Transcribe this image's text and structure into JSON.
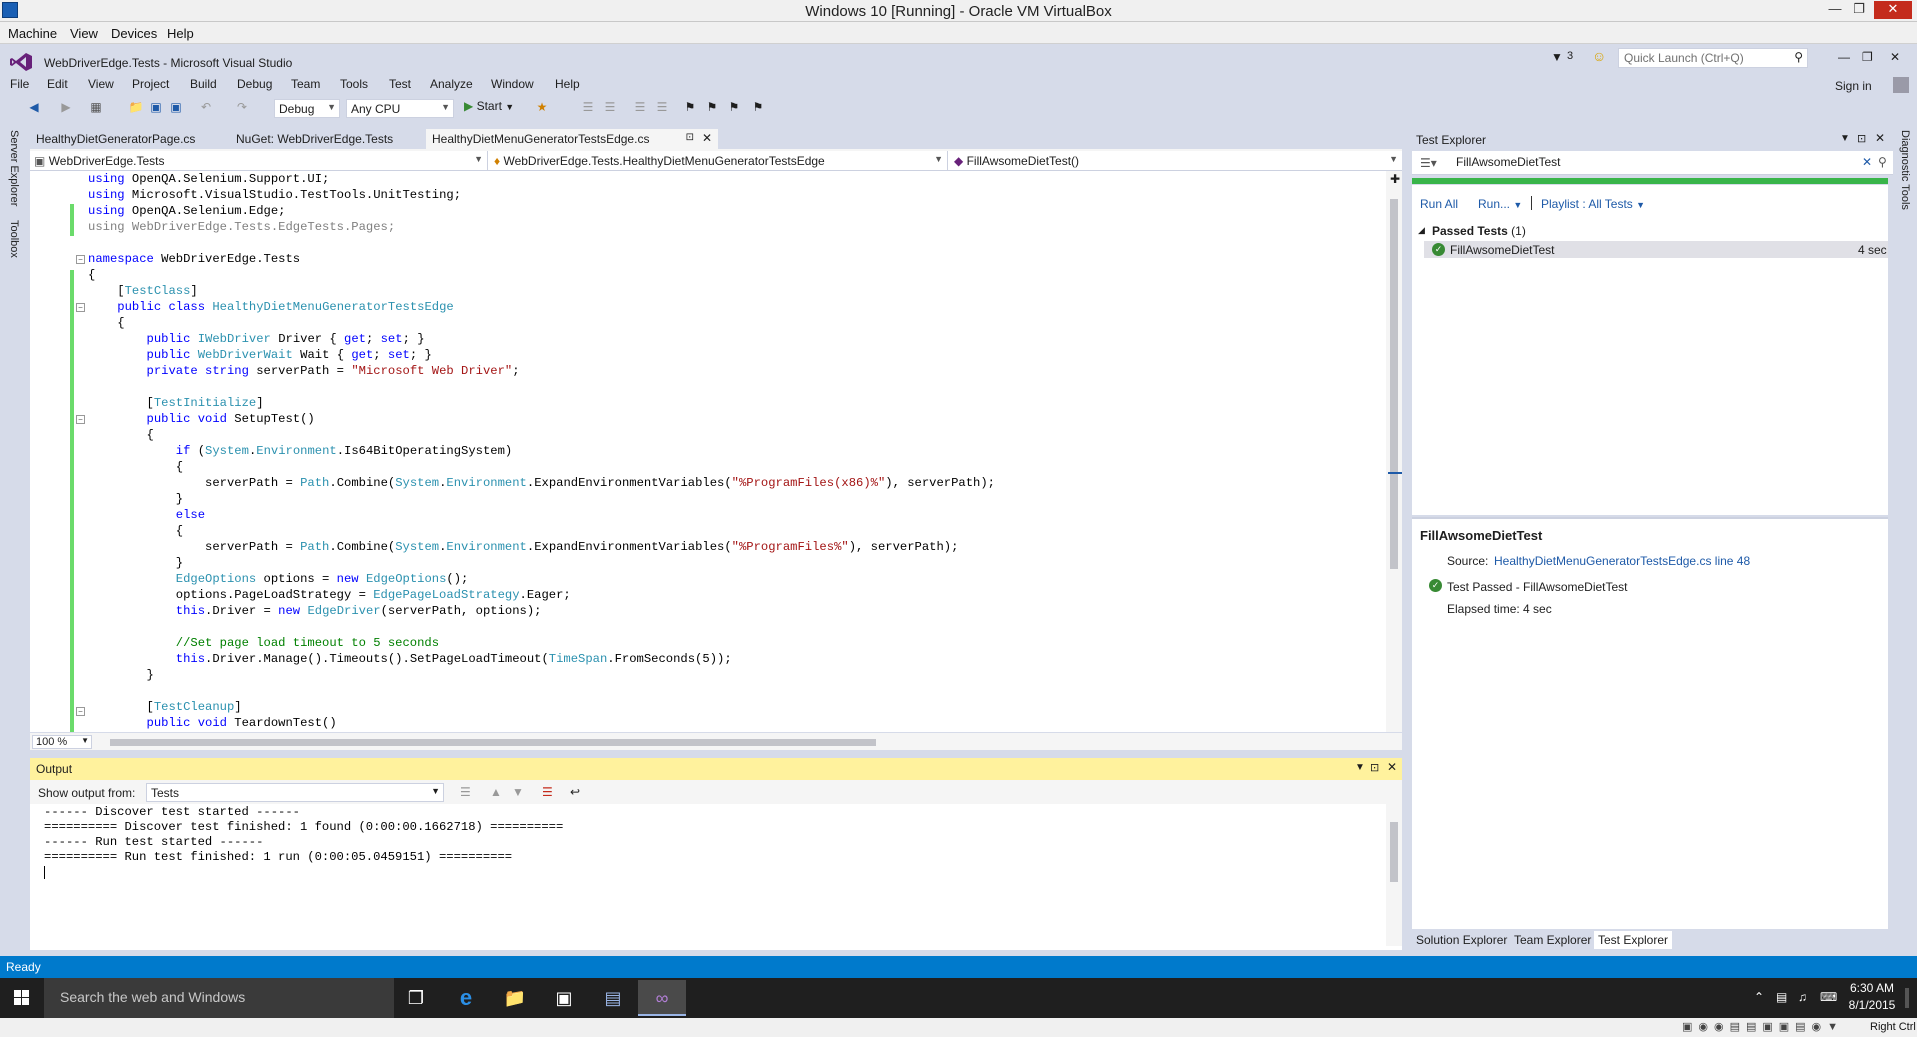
{
  "vbox": {
    "title": "Windows 10 [Running] - Oracle VM VirtualBox",
    "menu": [
      "Machine",
      "View",
      "Devices",
      "Help"
    ],
    "right_ctrl": "Right Ctrl"
  },
  "vs": {
    "title": "WebDriverEdge.Tests - Microsoft Visual Studio",
    "notifications": "3",
    "quick_launch_placeholder": "Quick Launch (Ctrl+Q)",
    "sign_in": "Sign in",
    "menu": [
      "File",
      "Edit",
      "View",
      "Project",
      "Build",
      "Debug",
      "Team",
      "Tools",
      "Test",
      "Analyze",
      "Window",
      "Help"
    ],
    "toolbar": {
      "config": "Debug",
      "platform": "Any CPU",
      "start": "Start"
    },
    "left_tabs": [
      "Server Explorer",
      "Toolbox"
    ],
    "right_tabs": [
      "Diagnostic Tools"
    ],
    "doc_tabs": [
      "HealthyDietGeneratorPage.cs",
      "NuGet: WebDriverEdge.Tests",
      "HealthyDietMenuGeneratorTestsEdge.cs"
    ],
    "nav": {
      "project": "WebDriverEdge.Tests",
      "class": "WebDriverEdge.Tests.HealthyDietMenuGeneratorTestsEdge",
      "member": "FillAwsomeDietTest()"
    },
    "zoom": "100 %",
    "status": "Ready"
  },
  "code_lines": [
    "using OpenQA.Selenium.Support.UI;",
    "using Microsoft.VisualStudio.TestTools.UnitTesting;",
    "using OpenQA.Selenium.Edge;",
    "using WebDriverEdge.Tests.EdgeTests.Pages;",
    "",
    "namespace WebDriverEdge.Tests",
    "{",
    "    [TestClass]",
    "    public class HealthyDietMenuGeneratorTestsEdge",
    "    {",
    "        public IWebDriver Driver { get; set; }",
    "        public WebDriverWait Wait { get; set; }",
    "        private string serverPath = \"Microsoft Web Driver\";",
    "",
    "        [TestInitialize]",
    "        public void SetupTest()",
    "        {",
    "            if (System.Environment.Is64BitOperatingSystem)",
    "            {",
    "                serverPath = Path.Combine(System.Environment.ExpandEnvironmentVariables(\"%ProgramFiles(x86)%\"), serverPath);",
    "            }",
    "            else",
    "            {",
    "                serverPath = Path.Combine(System.Environment.ExpandEnvironmentVariables(\"%ProgramFiles%\"), serverPath);",
    "            }",
    "            EdgeOptions options = new EdgeOptions();",
    "            options.PageLoadStrategy = EdgePageLoadStrategy.Eager;",
    "            this.Driver = new EdgeDriver(serverPath, options);",
    "",
    "            //Set page load timeout to 5 seconds",
    "            this.Driver.Manage().Timeouts().SetPageLoadTimeout(TimeSpan.FromSeconds(5));",
    "        }",
    "",
    "        [TestCleanup]",
    "        public void TeardownTest()"
  ],
  "test_explorer": {
    "title": "Test Explorer",
    "search_value": "FillAwsomeDietTest",
    "run_all": "Run All",
    "run": "Run...",
    "playlist": "Playlist : All Tests",
    "group_label": "Passed Tests",
    "group_count": "(1)",
    "test_name": "FillAwsomeDietTest",
    "test_time": "4 sec",
    "detail_title": "FillAwsomeDietTest",
    "source_label": "Source:",
    "source_link": "HealthyDietMenuGeneratorTestsEdge.cs line 48",
    "result": "Test Passed - FillAwsomeDietTest",
    "elapsed": "Elapsed time: 4 sec",
    "bottom_tabs": [
      "Solution Explorer",
      "Team Explorer",
      "Test Explorer"
    ]
  },
  "output": {
    "title": "Output",
    "show_from_label": "Show output from:",
    "show_from_value": "Tests",
    "lines": [
      "------ Discover test started ------",
      "========== Discover test finished: 1 found (0:00:00.1662718) ==========",
      "------ Run test started ------",
      "========== Run test finished: 1 run (0:00:05.0459151) =========="
    ]
  },
  "taskbar": {
    "search_placeholder": "Search the web and Windows",
    "time": "6:30 AM",
    "date": "8/1/2015"
  },
  "colors": {
    "status_bar": "#007acc",
    "pass": "#388a34",
    "progress": "#39b54a",
    "output_header": "#fff29d"
  }
}
